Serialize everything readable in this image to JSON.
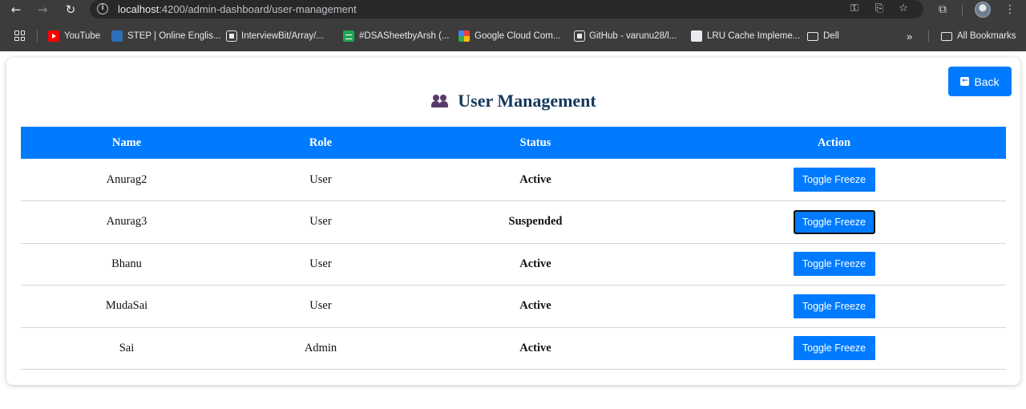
{
  "browser": {
    "url_host": "localhost",
    "url_rest": ":4200/admin-dashboard/user-management",
    "bookmarks": [
      {
        "label": "YouTube",
        "icon": "youtube-icon"
      },
      {
        "label": "STEP | Online Englis...",
        "icon": "step-icon"
      },
      {
        "label": "InterviewBit/Array/...",
        "icon": "github-icon"
      },
      {
        "label": "#DSASheetbyArsh (...",
        "icon": "sheets-icon"
      },
      {
        "label": "Google Cloud Com...",
        "icon": "google-cloud-icon"
      },
      {
        "label": "GitHub - varunu28/l...",
        "icon": "github-icon"
      },
      {
        "label": "LRU Cache Impleme...",
        "icon": "globe-icon"
      },
      {
        "label": "Dell",
        "icon": "folder-icon"
      }
    ],
    "overflow": "»",
    "all_bookmarks": "All Bookmarks"
  },
  "page": {
    "title": "User Management",
    "back_label": "Back",
    "columns": {
      "name": "Name",
      "role": "Role",
      "status": "Status",
      "action": "Action"
    },
    "users": [
      {
        "name": "Anurag2",
        "role": "User",
        "status": "Active",
        "action": "Toggle Freeze"
      },
      {
        "name": "Anurag3",
        "role": "User",
        "status": "Suspended",
        "action": "Toggle Freeze"
      },
      {
        "name": "Bhanu",
        "role": "User",
        "status": "Active",
        "action": "Toggle Freeze"
      },
      {
        "name": "MudaSai",
        "role": "User",
        "status": "Active",
        "action": "Toggle Freeze"
      },
      {
        "name": "Sai",
        "role": "Admin",
        "status": "Active",
        "action": "Toggle Freeze"
      }
    ]
  },
  "colors": {
    "primary": "#007bff",
    "title": "#13385c",
    "active": "#1a8a1a",
    "suspended": "#e01515"
  }
}
